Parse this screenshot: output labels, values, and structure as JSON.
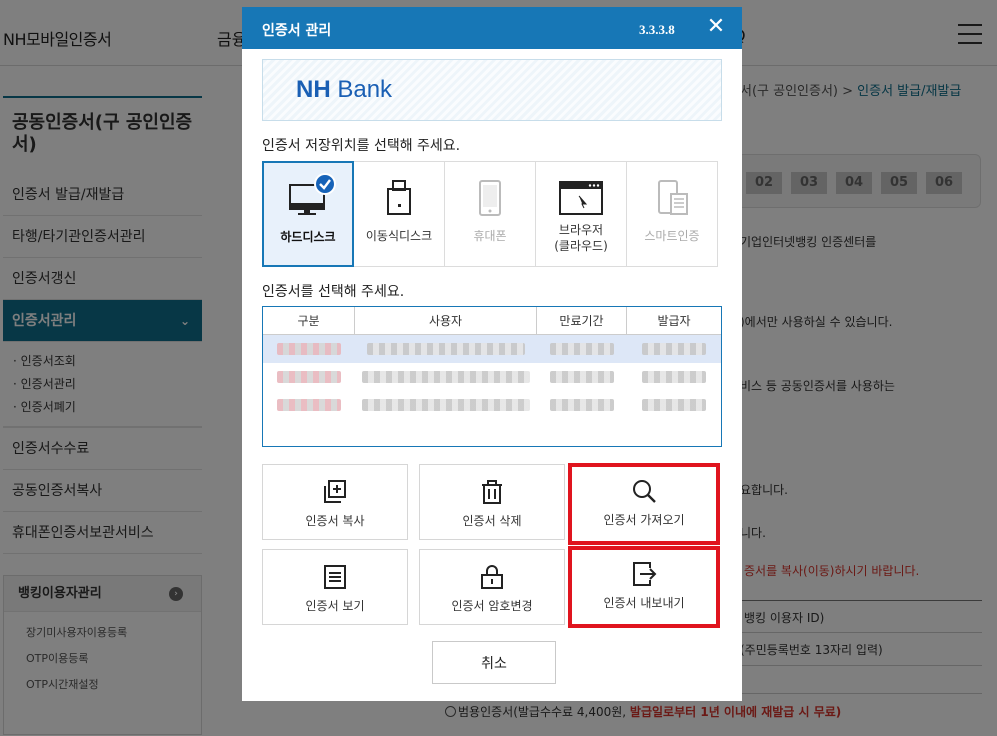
{
  "page": {
    "site_title": "NH모바일인증서",
    "nav_partial": "금융",
    "nav_partial_right": "Q",
    "breadcrumb_prefix": "서(구 공인인증서) > ",
    "breadcrumb_current": "인증서 발급/재발급",
    "steps": [
      "02",
      "03",
      "04",
      "05",
      "06"
    ],
    "lines": [
      "기업인터넷뱅킹 인증센터를",
      ")에서만 사용하실 수 있습니다.",
      "비스 등 공동인증서를 사용하는",
      "요합니다.",
      "니다.",
      "증서를 복사(이동)하시기 바랍니다.",
      "뱅킹 이용자 ID)",
      "(주민등록번호 13자리 입력)"
    ],
    "bottom_text": "범용인증서(발급수수료 4,400원, ",
    "bottom_text_red": "발급일로부터 1년 이내에 재발급 시 무료)"
  },
  "sidebar": {
    "title": "공동인증서(구 공인인증서)",
    "items": [
      "인증서 발급/재발급",
      "타행/타기관인증서관리",
      "인증서갱신",
      "인증서관리"
    ],
    "submenu": [
      "· 인증서조회",
      "· 인증서관리",
      "· 인증서폐기"
    ],
    "items_after": [
      "인증서수수료",
      "공동인증서복사",
      "휴대폰인증서보관서비스"
    ],
    "box_title": "뱅킹이용자관리",
    "box_items": [
      "장기미사용자이용등록",
      "OTP이용등록",
      "OTP시간재설정"
    ]
  },
  "modal": {
    "title": "인증서 관리",
    "version": "3.3.3.8",
    "close_glyph": "✕",
    "logo_nh": "NH",
    "logo_bank": " Bank",
    "location_prompt": "인증서 저장위치를 선택해 주세요.",
    "locations": [
      {
        "label": "하드디스크",
        "icon": "monitor-icon",
        "selected": true
      },
      {
        "label": "이동식디스크",
        "icon": "usb-drive-icon"
      },
      {
        "label": "휴대폰",
        "icon": "phone-icon",
        "disabled": true
      },
      {
        "label": "브라우저\n(클라우드)",
        "icon": "browser-icon"
      },
      {
        "label": "스마트인증",
        "icon": "smart-auth-icon",
        "disabled": true
      }
    ],
    "cert_prompt": "인증서를 선택해 주세요.",
    "table_headers": [
      "구분",
      "사용자",
      "만료기간",
      "발급자"
    ],
    "table_rows": 3,
    "actions": [
      {
        "label": "인증서 복사",
        "icon": "copy-icon"
      },
      {
        "label": "인증서 삭제",
        "icon": "trash-icon"
      },
      {
        "label": "인증서 가져오기",
        "icon": "search-icon",
        "highlighted": true
      },
      {
        "label": "인증서 보기",
        "icon": "document-icon"
      },
      {
        "label": "인증서 암호변경",
        "icon": "lock-icon"
      },
      {
        "label": "인증서 내보내기",
        "icon": "export-icon",
        "highlighted": true
      }
    ],
    "cancel_label": "취소"
  },
  "colors": {
    "modal_header": "#1777b6",
    "sidebar_active": "#0f6e8c",
    "highlight": "#e0141e",
    "selected_bg": "#e8f1fb"
  }
}
